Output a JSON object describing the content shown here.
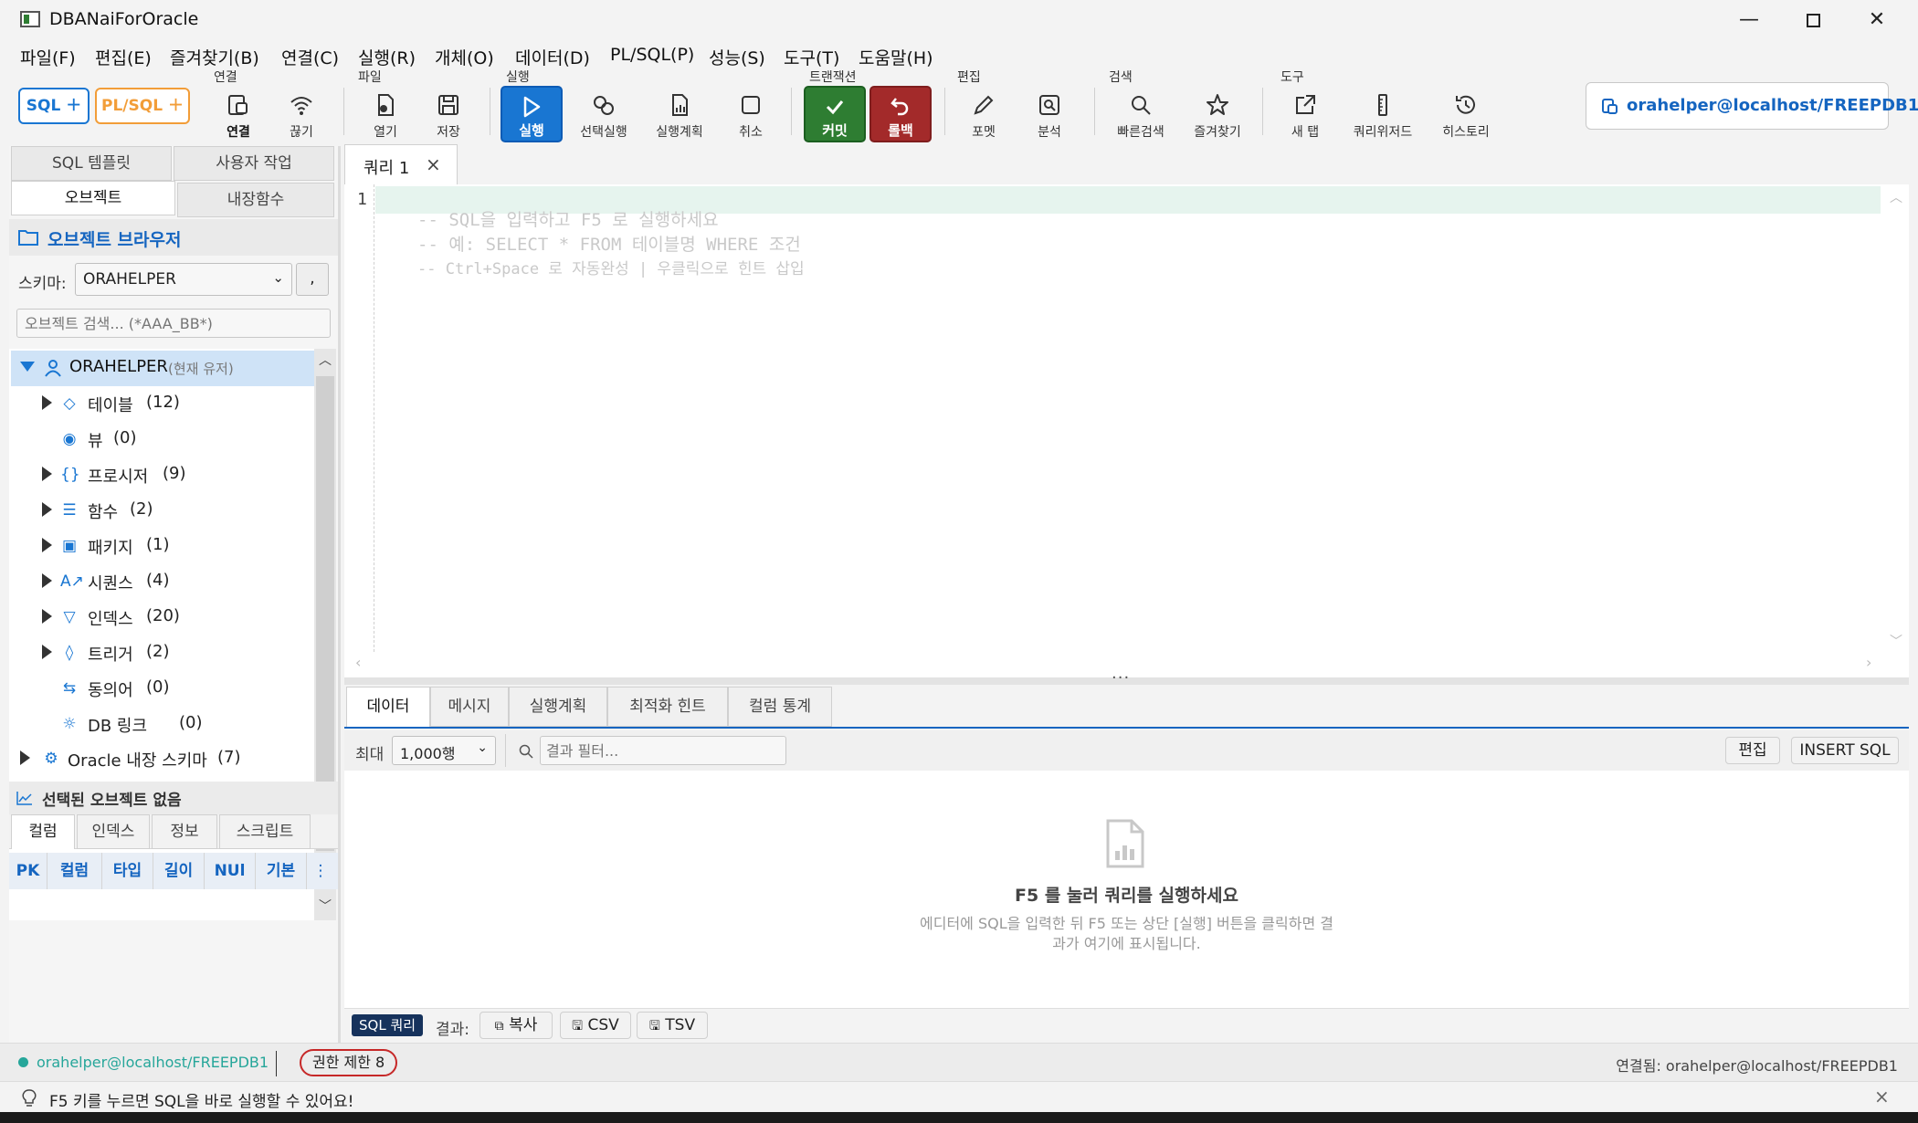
{
  "window": {
    "title": "DBANaiForOracle"
  },
  "menu": [
    "파일(F)",
    "편집(E)",
    "즐겨찾기(B)",
    "연결(C)",
    "실행(R)",
    "개체(O)",
    "데이터(D)",
    "PL/SQL(P)",
    "성능(S)",
    "도구(T)",
    "도움말(H)"
  ],
  "toolbar": {
    "sql_btn": "SQL ＋",
    "plsql_btn": "PL/SQL ＋",
    "groups": {
      "connect": "연결",
      "file": "파일",
      "run": "실행",
      "tx": "트랜잭션",
      "edit": "편집",
      "search": "검색",
      "tools": "도구"
    },
    "connect": "연결",
    "disconnect": "끊기",
    "open": "열기",
    "save": "저장",
    "run": "실행",
    "run_selected": "선택실행",
    "explain": "실행계획",
    "cancel": "취소",
    "commit": "커밋",
    "rollback": "롤백",
    "format": "포멧",
    "analyze": "분석",
    "quick_search": "빠른검색",
    "favorites": "즐겨찾기",
    "new_tab": "새 탭",
    "query_wizard": "쿼리위저드",
    "history": "히스토리",
    "connection": "orahelper@localhost/FREEPDB1",
    "accent": "#1976d2",
    "commit_color": "#2e7d32",
    "rollback_color": "#a32a2a"
  },
  "left": {
    "tabs": [
      "SQL 템플릿",
      "사용자 작업",
      "오브젝트",
      "내장함수"
    ],
    "browser_title": "오브젝트 브라우저",
    "schema_label": "스키마:",
    "schema_value": "ORAHELPER",
    "schema_btn": ",",
    "search_placeholder": "오브젝트 검색... (*AAA_BB*)",
    "tree": {
      "root": "ORAHELPER",
      "root_note": "(현재 유저)",
      "items": [
        {
          "label": "테이블",
          "count": "(12)",
          "icon": "tag-icon",
          "glyph": "◇"
        },
        {
          "label": "뷰",
          "count": "(0)",
          "icon": "eye-icon",
          "glyph": "◉"
        },
        {
          "label": "프로시저",
          "count": "(9)",
          "icon": "braces-icon",
          "glyph": "{}"
        },
        {
          "label": "함수",
          "count": "(2)",
          "icon": "list-icon",
          "glyph": "☰"
        },
        {
          "label": "패키지",
          "count": "(1)",
          "icon": "package-icon",
          "glyph": "▣"
        },
        {
          "label": "시퀀스",
          "count": "(4)",
          "icon": "sequence-icon",
          "glyph": "A↗"
        },
        {
          "label": "인덱스",
          "count": "(20)",
          "icon": "filter-icon",
          "glyph": "▽"
        },
        {
          "label": "트리거",
          "count": "(2)",
          "icon": "trigger-icon",
          "glyph": "◊"
        },
        {
          "label": "동의어",
          "count": "(0)",
          "icon": "synonym-icon",
          "glyph": "⇆"
        },
        {
          "label": "DB 링크",
          "count": "(0)",
          "icon": "dblink-icon",
          "glyph": "☼"
        }
      ],
      "builtin": "Oracle 내장 스키마",
      "builtin_count": "(7)"
    },
    "detail_title": "선택된 오브젝트 없음",
    "detail_tabs": [
      "컬럼",
      "인덱스",
      "정보",
      "스크립트"
    ],
    "columns": [
      "PK",
      "컬럼",
      "타입",
      "길이",
      "NUl",
      "기본"
    ],
    "more": "⋮"
  },
  "editor": {
    "tab": "쿼리 1",
    "line_number": "1",
    "hints": [
      "-- SQL을 입력하고 F5 로 실행하세요",
      "-- 예: SELECT * FROM 테이블명 WHERE 조건",
      "-- Ctrl+Space 로 자동완성 | 우클릭으로 힌트 삽입"
    ]
  },
  "results": {
    "tabs": [
      "데이터",
      "메시지",
      "실행계획",
      "최적화 힌트",
      "컬럼 통계"
    ],
    "max_label": "최대",
    "max_value": "1,000행",
    "filter_placeholder": "결과 필터...",
    "edit_btn": "편집",
    "insert_btn": "INSERT SQL",
    "empty_title": "F5 를 눌러 쿼리를 실행하세요",
    "empty_desc_1": "에디터에 SQL을 입력한 뒤 F5 또는 상단 [실행] 버튼을 클릭하면 결",
    "empty_desc_2": "과가 여기에 표시됩니다.",
    "sql_badge": "SQL 쿼리",
    "result_label": "결과:",
    "copy_btn": "복사",
    "csv_btn": "CSV",
    "tsv_btn": "TSV"
  },
  "status": {
    "connection": "orahelper@localhost/FREEPDB1",
    "limit": "권한 제한 8",
    "connected": "연결됨: orahelper@localhost/FREEPDB1",
    "tip": "F5 키를 누르면 SQL을 바로 실행할 수 있어요!",
    "close": "×"
  }
}
